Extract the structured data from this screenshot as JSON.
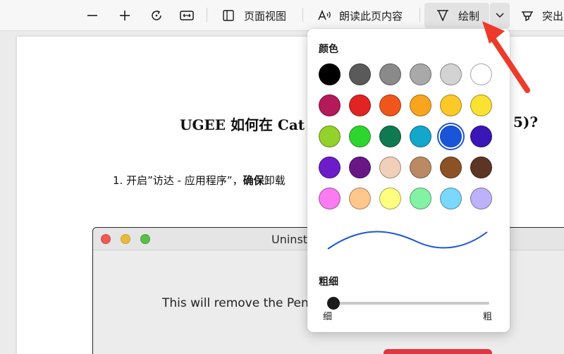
{
  "toolbar": {
    "page_view_label": "页面视图",
    "read_aloud_label": "朗读此页内容",
    "draw_label": "绘制",
    "highlight_label": "突出"
  },
  "document": {
    "title_left": "UGEE 如何在 Cat",
    "title_right": "5)?",
    "step_prefix": "1.  开启”访达 - 应用程序”，",
    "step_bold": "确保",
    "step_suffix": "卸载",
    "embedded_window": {
      "title": "Uninst",
      "message": "This will remove the Pen"
    }
  },
  "draw_popover": {
    "color_heading": "颜色",
    "thickness_heading": "粗细",
    "thin_label": "细",
    "thick_label": "粗",
    "selected_color": "#1a55d8",
    "stroke_thickness": 0.0,
    "colors": [
      [
        "#000000",
        "#5a5a5a",
        "#8a8a8a",
        "#a9a9a9",
        "#d3d3d3",
        "#ffffff"
      ],
      [
        "#b3195b",
        "#e02424",
        "#f0561a",
        "#f8a51d",
        "#fdc926",
        "#fbe132"
      ],
      [
        "#93d22a",
        "#2fd52f",
        "#0f7a52",
        "#13a7cc",
        "#1a55d8",
        "#3a16b6"
      ],
      [
        "#6c1cc8",
        "#6a1786",
        "#f2cfb8",
        "#b98a63",
        "#8b5226",
        "#5e3525"
      ],
      [
        "#fb7bf1",
        "#ffc78c",
        "#feff7f",
        "#84f2a4",
        "#79d8fc",
        "#bdb2fa"
      ]
    ]
  }
}
